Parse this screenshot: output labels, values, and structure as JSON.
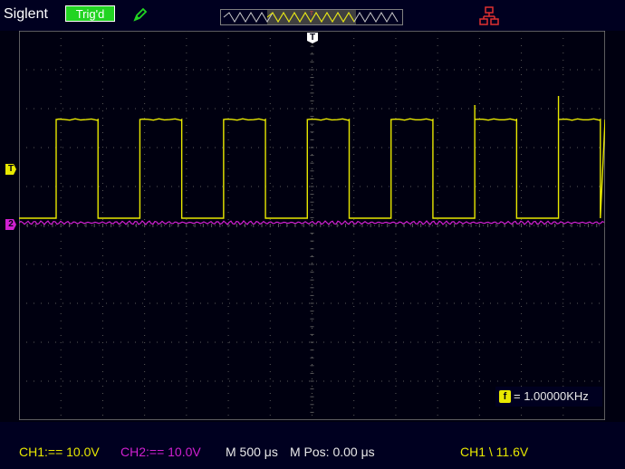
{
  "header": {
    "brand": "Siglent",
    "trigger_status": "Trig'd"
  },
  "markers": {
    "trigger_top": "T",
    "trigger_level": "T",
    "ch2_ground": "2"
  },
  "measurement": {
    "freq_icon": "f",
    "freq_value": "= 1.00000KHz"
  },
  "status_bar": {
    "ch1": "CH1:== 10.0V",
    "ch2": "CH2:== 10.0V",
    "timebase": "M 500 μs",
    "mpos": "M Pos: 0.00 μs",
    "trigger": "CH1 \\ 11.6V"
  },
  "colors": {
    "ch1": "#e8e800",
    "ch2": "#d020d0",
    "trig_badge": "#22d422",
    "background": "#000010"
  },
  "icons": {
    "pen": "pen-icon",
    "network": "network-icon",
    "trigger_marker": "trigger-marker-icon"
  }
}
